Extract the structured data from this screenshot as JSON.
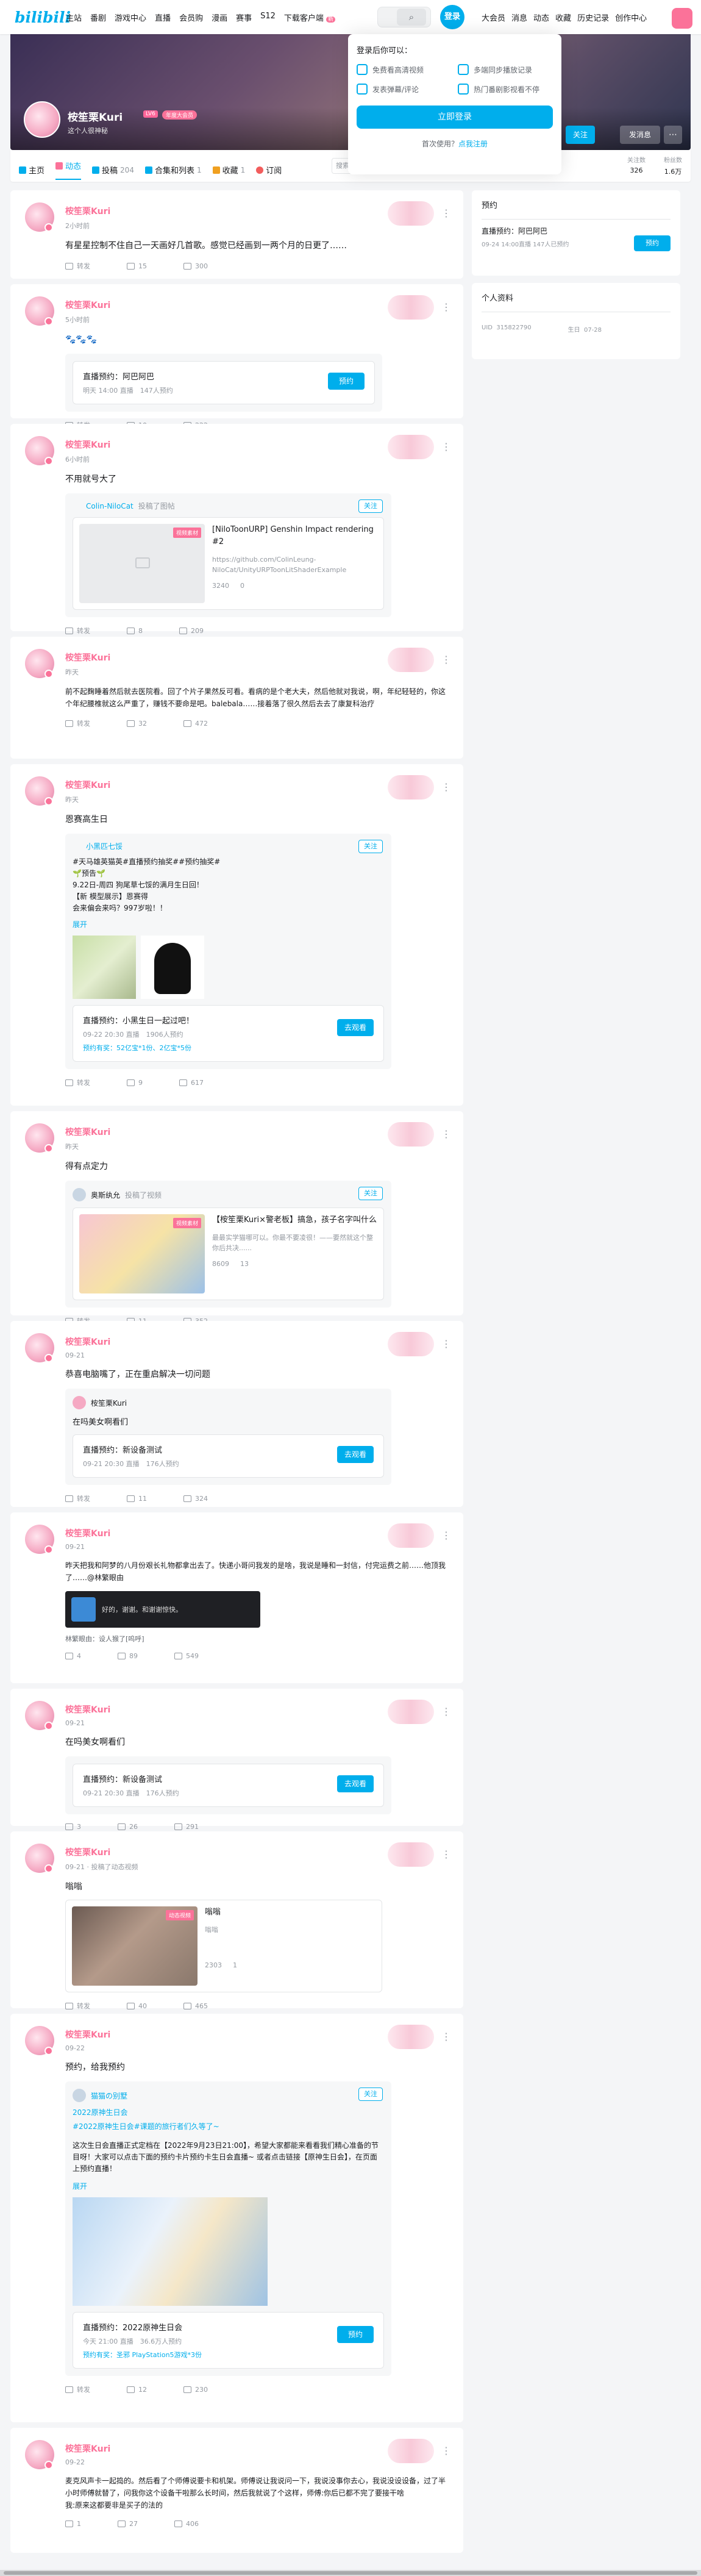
{
  "topbar": {
    "logo": "bilibili",
    "nav_left": [
      "主站",
      "番剧",
      "游戏中心",
      "直播",
      "会员购",
      "漫画",
      "赛事",
      "S12",
      "下载客户端"
    ],
    "download_badge": "新",
    "login": "登录",
    "nav_right": [
      "大会员",
      "消息",
      "动态",
      "收藏",
      "历史记录",
      "创作中心"
    ]
  },
  "login_popup": {
    "title": "登录后你可以：",
    "perks": [
      "免费看高清视频",
      "多端同步播放记录",
      "发表弹幕/评论",
      "热门番剧影视看不停"
    ],
    "button": "立即登录",
    "first_use": "首次使用？",
    "register": "点我注册"
  },
  "profile": {
    "name": "桉笙栗Kuri",
    "level": "LV6",
    "vip": "年度大会员",
    "sign": "这个人很神秘",
    "follow_label": "关注",
    "message_label": "发消息",
    "more_label": "⋯"
  },
  "tabs": [
    {
      "label": "主页",
      "count": "",
      "color": "#00aeec"
    },
    {
      "label": "动态",
      "count": "",
      "color": "#fb7299"
    },
    {
      "label": "投稿",
      "count": "204",
      "color": "#00aeec"
    },
    {
      "label": "合集和列表",
      "count": "1",
      "color": "#00aeec"
    },
    {
      "label": "收藏",
      "count": "1",
      "color": "#f0a020"
    },
    {
      "label": "订阅",
      "count": "",
      "color": "#f25d5d"
    }
  ],
  "space_search_placeholder": "搜索视频、动态",
  "stats": [
    {
      "label": "关注数",
      "value": "326"
    },
    {
      "label": "粉丝数",
      "value": "1.6万"
    }
  ],
  "posts": [
    {
      "name": "桉笙栗Kuri",
      "time": "2小时前",
      "text": "有星星控制不住自己一天画好几首歌。感觉已经画到一两个月的日更了……",
      "share": "转发",
      "comment": "15",
      "like": "300"
    },
    {
      "name": "桉笙栗Kuri",
      "time": "5小时前",
      "text": "",
      "live": {
        "title": "直播预约：阿巴阿巴",
        "sub": "明天 14:00 直播　147人预约",
        "btn": "预约"
      },
      "share": "转发",
      "comment": "10",
      "like": "222"
    },
    {
      "name": "桉笙栗Kuri",
      "time": "6小时前",
      "text": "不用就号大了",
      "fwd": {
        "user": "Colin-NiloCat",
        "action": "投稿了图帖",
        "follow": "关注",
        "tag": "视频素材",
        "title": "[NiloToonURP] Genshin Impact rendering #2",
        "desc": "https://github.com/ColinLeung-NiloCat/UnityURPToonLitShaderExample",
        "views": "3240",
        "comments": "0"
      },
      "share": "转发",
      "comment": "8",
      "like": "209"
    },
    {
      "name": "桉笙栗Kuri",
      "time": "昨天",
      "text": "前不起麴睡着然后就去医院看。回了个片子果然反可看。看病的是个老大夫，然后他就对我说，啊，年纪轻轻的，你这个年纪腰椎就这么严重了，赚钱不要命是吧。balebala……接着落了很久然后去去了康复科治疗",
      "share": "转发",
      "comment": "32",
      "like": "472"
    },
    {
      "name": "桉笙栗Kuri",
      "time": "昨天",
      "text": "恩赛高生日",
      "fwd": {
        "user": "小黑匹七馁",
        "follow": "关注",
        "text": "#天马雄英猫英#直播预约抽奖##预约抽奖#\n🌱预告🌱\n9.22日-周四 狗尾草七馁的满月生日回！\n【新 模型展示】恩赛得\n会来偏会来吗？997岁啦！！",
        "expand": "展开",
        "live_title": "直播预约：小黑生日一起过吧！",
        "live_sub": "09-22 20:30 直播　1906人预约",
        "live_extra": "预约有奖：52亿宝*1份、2亿宝*5份",
        "live_btn": "去观看"
      },
      "share": "转发",
      "comment": "9",
      "like": "617"
    },
    {
      "name": "桉笙栗Kuri",
      "time": "昨天",
      "text": "得有点定力",
      "fwd": {
        "user": "奥斯纨允",
        "action": "投稿了视频",
        "follow": "关注",
        "tag": "视频素材",
        "title": "【桉笙栗Kuri×警老板】搞急，孩子名字叫什么",
        "desc": "最最实学猫哪可以。你最不要凌很！——要然就这个整你后共决......",
        "views": "8609",
        "comments": "13"
      },
      "share": "转发",
      "comment": "11",
      "like": "352"
    },
    {
      "name": "桉笙栗Kuri",
      "time": "09-21",
      "text": "恭喜电脑嘴了，正在重启解决一切问题",
      "fwd": {
        "user": "桉笙栗Kuri",
        "text": "在吗美女啊看们",
        "live_title": "直播预约：新设备测试",
        "live_sub": "09-21 20:30 直播　176人预约",
        "live_btn": "去观看"
      },
      "share": "转发",
      "comment": "11",
      "like": "324"
    },
    {
      "name": "桉笙栗Kuri",
      "time": "09-21",
      "text": "昨天把我和阿梦的八月份艰长礼物都拿出去了。快递小哥问我发的是啥，我说是睡和一封信，付完运费之前……他顶我了……@林繁眼由",
      "vote": "好的，谢谢。和谢谢惊快。",
      "vote_footer": "林繁眼由：设人猴了[呜呼]",
      "share": "4",
      "comment": "89",
      "like": "549"
    },
    {
      "name": "桉笙栗Kuri",
      "time": "09-21",
      "text": "在吗美女啊看们",
      "live": {
        "title": "直播预约：新设备测试",
        "sub": "09-21 20:30 直播　176人预约",
        "btn": "去观看"
      },
      "share": "3",
      "comment": "26",
      "like": "291"
    },
    {
      "name": "桉笙栗Kuri",
      "time": "09-21 · 投稿了动态视频",
      "text": "嗡嗡",
      "video": {
        "tag": "动态视频",
        "title": "嗡嗡",
        "desc": "嗡嗡",
        "views": "2303",
        "comments": "1"
      },
      "share": "转发",
      "comment": "40",
      "like": "465"
    },
    {
      "name": "桉笙栗Kuri",
      "time": "09-22",
      "text": "预约，给我预约",
      "fwd": {
        "user": "猫猫の别墅",
        "follow": "关注",
        "sub_title": "2022原神生日会",
        "tags": "#2022原神生日会#课题的旅行者们久等了~",
        "text": "这次生日会直播正式定档在【2022年9月23日21:00】，希望大家都能来看看我们精心准备的节目呀！大家可以点击下面的预约卡片预约卡生日会直播~ 或者点击链接【原神生日会】，在页面上预约直播！",
        "expand": "展开",
        "live_title": "直播预约：2022原神生日会",
        "live_sub": "今天 21:00 直播　36.6万人预约",
        "live_extra": "预约有奖：圣邪 PlayStation5游戏*3份",
        "live_btn": "预约"
      },
      "share": "转发",
      "comment": "12",
      "like": "230"
    },
    {
      "name": "桉笙栗Kuri",
      "time": "09-22",
      "text": "麦克风声卡一起捣的。然后看了个师傅说要卡和机架。师傅说让我说问一下，我说没事你去心，我说没设设备，过了半小时师傅就替了，问我你这个设备干啦那么长时间，然后我就说了个这样，师傅:你后已都不完了要接干啥\n我:原来这都要非是买子的法的",
      "share": "1",
      "comment": "27",
      "like": "406"
    }
  ],
  "side": {
    "booking_title": "预约",
    "booking_item": "直播预约：阿巴阿巴",
    "booking_sub": "09-24 14:00直播 147人已预约",
    "booking_btn": "预约",
    "info_title": "个人资料",
    "uid_label": "UID",
    "uid": "315822790",
    "birthday_label": "生日",
    "birthday": "07-28"
  }
}
